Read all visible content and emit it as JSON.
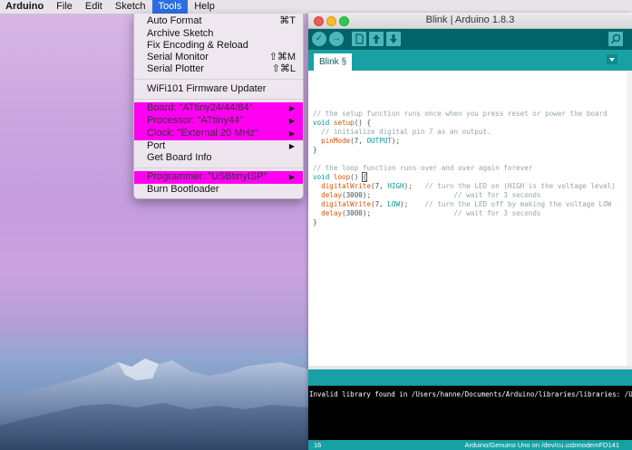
{
  "menubar": {
    "app": "Arduino",
    "items": [
      "File",
      "Edit",
      "Sketch",
      "Tools",
      "Help"
    ],
    "active": "Tools"
  },
  "tools_menu": {
    "auto_format": "Auto Format",
    "auto_format_sc": "⌘T",
    "archive_sketch": "Archive Sketch",
    "fix_encoding": "Fix Encoding & Reload",
    "serial_monitor": "Serial Monitor",
    "serial_monitor_sc": "⇧⌘M",
    "serial_plotter": "Serial Plotter",
    "serial_plotter_sc": "⇧⌘L",
    "wifi_updater": "WiFi101 Firmware Updater",
    "board": "Board: \"ATtiny24/44/84\"",
    "processor": "Processor: \"ATtiny44\"",
    "clock": "Clock: \"External 20 MHz\"",
    "port": "Port",
    "board_info": "Get Board Info",
    "programmer": "Programmer: \"USBtinyISP\"",
    "burn_bootloader": "Burn Bootloader",
    "submenu_arrow": "▶",
    "highlight_color": "#ff00f0"
  },
  "window": {
    "title": "Blink | Arduino 1.8.3",
    "tab": "Blink §"
  },
  "code": {
    "l1c": "// the setup function runs once when you press reset or power the board",
    "l2a": "void",
    "l2b": "setup",
    "l2c": "() {",
    "l3c": "  // initialize digital pin 7 as an output.",
    "l4a": "  ",
    "l4b": "pinMode",
    "l4c": "(7, ",
    "l4d": "OUTPUT",
    "l4e": ");",
    "l5": "}",
    "l7c": "// the loop function runs over and over again forever",
    "l8a": "void",
    "l8b": "loop",
    "l8c": "() ",
    "l8d": "{",
    "l9a": "  ",
    "l9b": "digitalWrite",
    "l9c": "(7, ",
    "l9d": "HIGH",
    "l9e": ");   ",
    "l9f": "// turn the LED on (HIGH is the voltage level)",
    "l10a": "  ",
    "l10b": "delay",
    "l10c": "(3000);                    ",
    "l10d": "// wait for 3 seconds",
    "l11a": "  ",
    "l11b": "digitalWrite",
    "l11c": "(7, ",
    "l11d": "LOW",
    "l11e": ");    ",
    "l11f": "// turn the LED off by making the voltage LOW",
    "l12a": "  ",
    "l12b": "delay",
    "l12c": "(3000);                    ",
    "l12d": "// wait for 3 seconds",
    "l13": "}"
  },
  "console": {
    "text": "Invalid library found in /Users/hanne/Documents/Arduino/libraries/libraries: /Users"
  },
  "status": {
    "line": "16",
    "board": "Arduino/Genuino Uno on /dev/cu.usbmodemFD141"
  },
  "toolbar": {
    "verify_icon": "✓",
    "upload_icon": "→"
  }
}
